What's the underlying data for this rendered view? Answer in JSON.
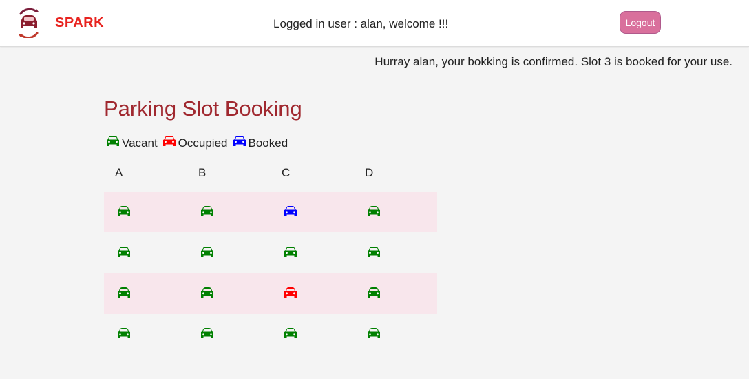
{
  "brand": {
    "name": "SPARK"
  },
  "header": {
    "welcome": "Logged in user : alan, welcome !!!",
    "logout_label": "Logout"
  },
  "notice": "Hurray alan, your bokking is confirmed. Slot 3 is booked for your use.",
  "main": {
    "title": "Parking Slot Booking",
    "legend": [
      {
        "label": "Vacant",
        "icon": "car-icon",
        "color": "#008000"
      },
      {
        "label": "Occupied",
        "icon": "car-icon",
        "color": "#ff0000"
      },
      {
        "label": "Booked",
        "icon": "car-icon",
        "color": "#0000ff"
      }
    ],
    "columns": [
      "A",
      "B",
      "C",
      "D"
    ],
    "rows": [
      [
        "vacant",
        "vacant",
        "booked",
        "vacant"
      ],
      [
        "vacant",
        "vacant",
        "vacant",
        "vacant"
      ],
      [
        "vacant",
        "vacant",
        "occupied",
        "vacant"
      ],
      [
        "vacant",
        "vacant",
        "vacant",
        "vacant"
      ]
    ],
    "status_colors": {
      "vacant": "#008000",
      "occupied": "#ff0000",
      "booked": "#0000ff"
    }
  }
}
